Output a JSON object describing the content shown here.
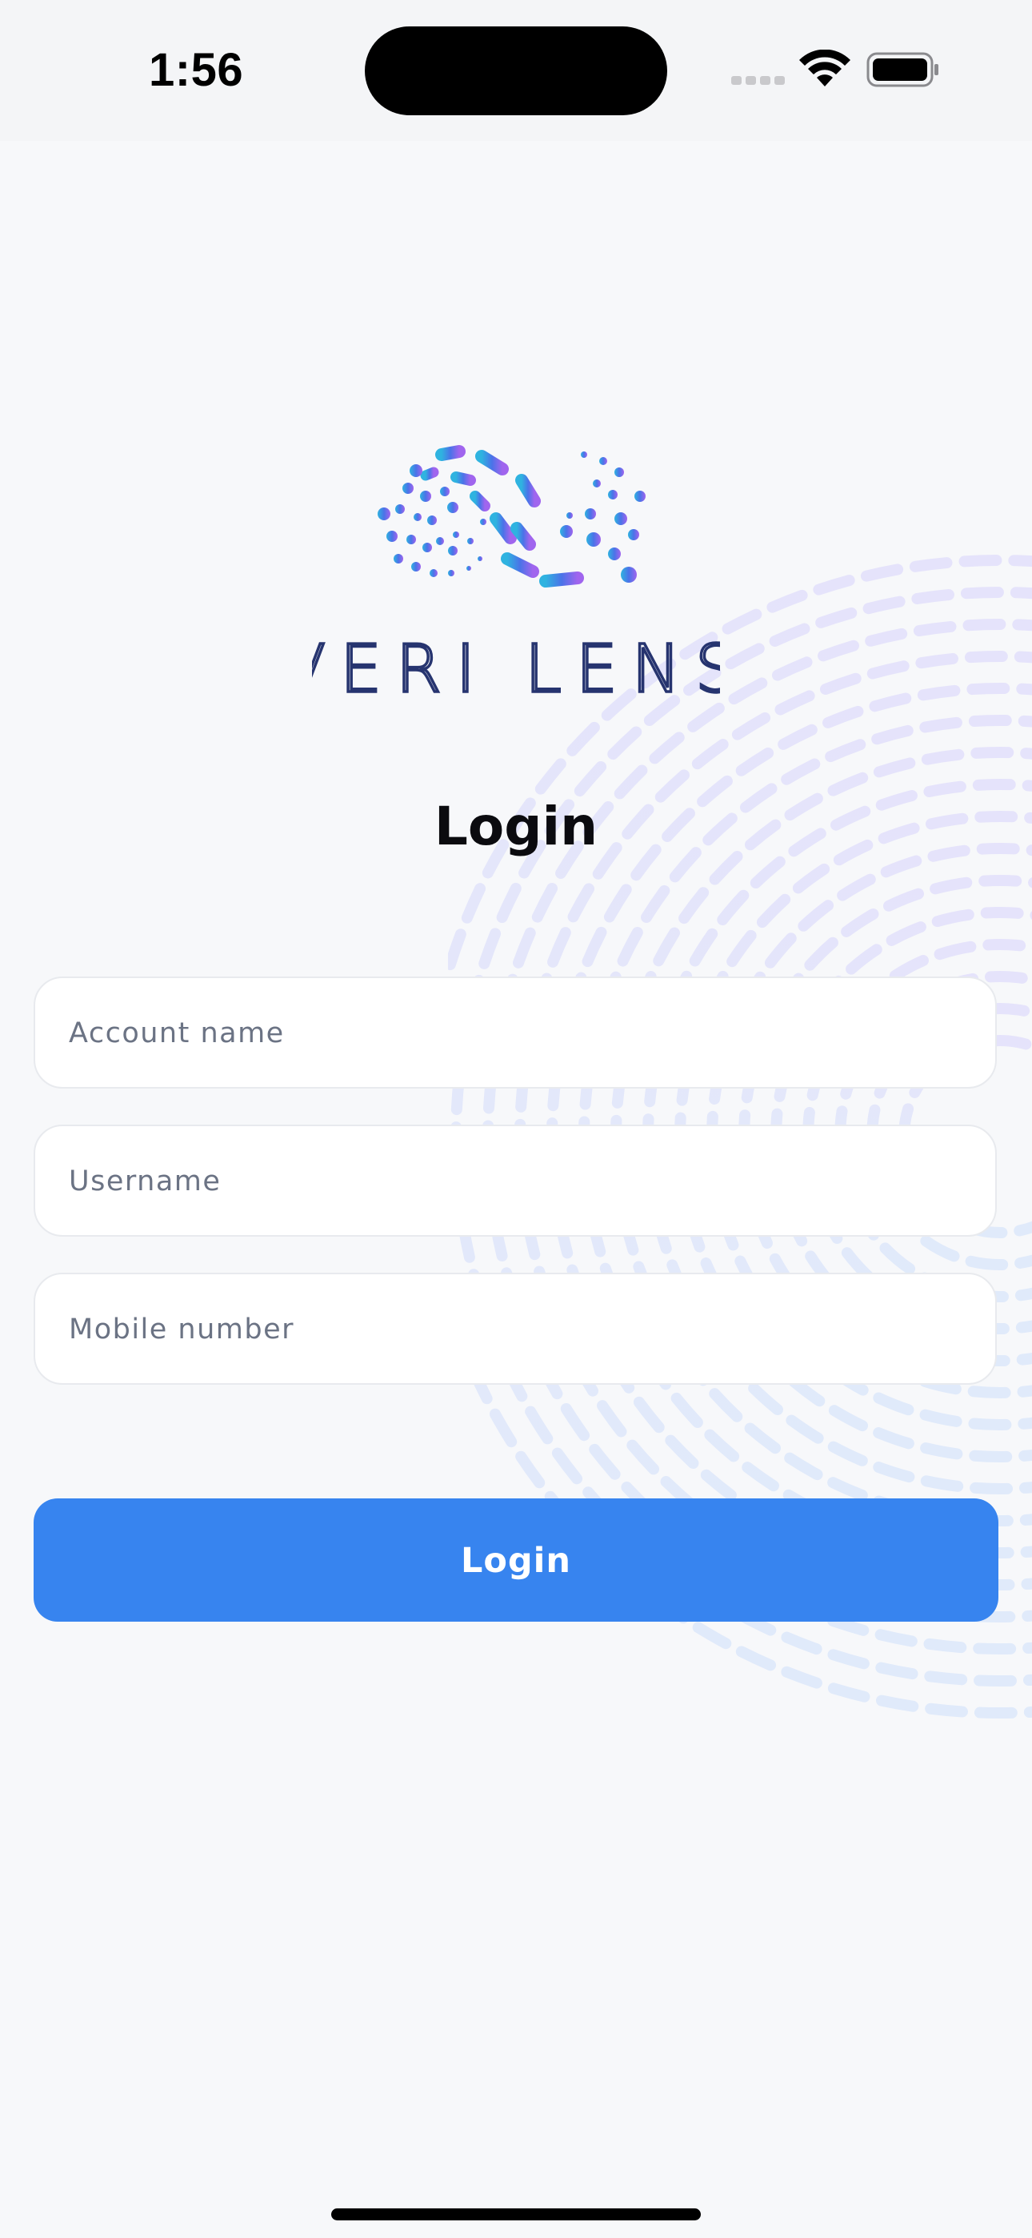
{
  "status_bar": {
    "time": "1:56",
    "icons": [
      "signal-icon",
      "wifi-icon",
      "battery-icon"
    ]
  },
  "brand": {
    "name": "VERI LENS",
    "logo_icon": "infinity-dots-logo",
    "wordmark_color": "#26346f"
  },
  "login": {
    "title": "Login",
    "fields": {
      "account_name": {
        "placeholder": "Account name",
        "value": ""
      },
      "username": {
        "placeholder": "Username",
        "value": ""
      },
      "mobile_number": {
        "placeholder": "Mobile number",
        "value": ""
      }
    },
    "button_label": "Login"
  },
  "colors": {
    "accent": "#3784ef",
    "background": "#f7f8fa",
    "placeholder": "#6b7384"
  }
}
